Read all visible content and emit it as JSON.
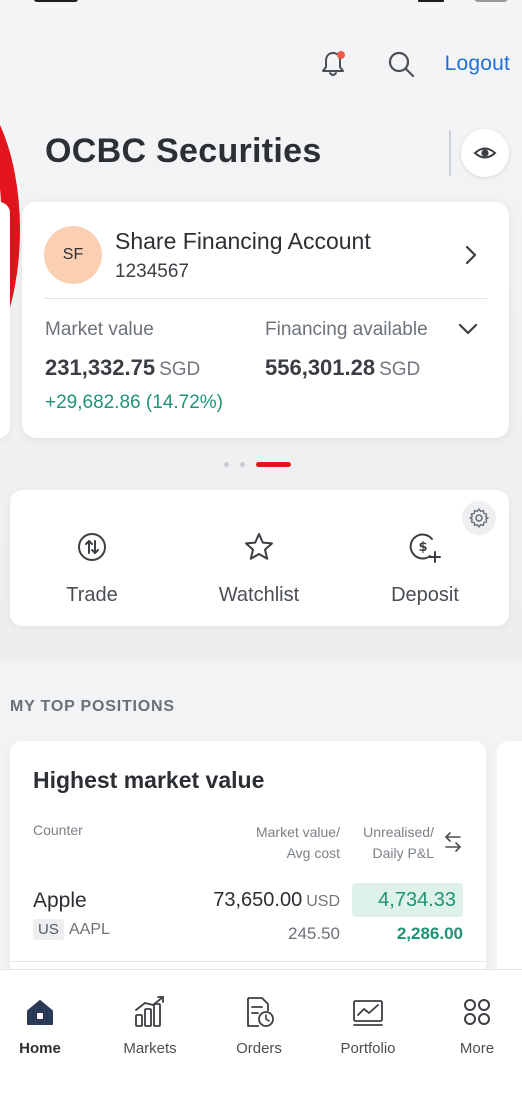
{
  "header": {
    "logout_label": "Logout",
    "brand_title": "OCBC Securities",
    "notification_dot_color": "#f25a4e"
  },
  "account": {
    "avatar_initials": "SF",
    "name": "Share Financing Account",
    "number": "1234567",
    "market_value_label": "Market value",
    "market_value": "231,332.75",
    "market_value_currency": "SGD",
    "market_value_change": "+29,682.86 (14.72%)",
    "financing_label": "Financing available",
    "financing_value": "556,301.28",
    "financing_currency": "SGD",
    "carousel_active_index": 2,
    "carousel_count": 3
  },
  "quick_actions": [
    {
      "label": "Trade",
      "icon": "trade-icon"
    },
    {
      "label": "Watchlist",
      "icon": "star-icon"
    },
    {
      "label": "Deposit",
      "icon": "deposit-icon"
    }
  ],
  "positions": {
    "section_label": "MY TOP POSITIONS",
    "card_title": "Highest market value",
    "col_counter": "Counter",
    "col_mv_line1": "Market value/",
    "col_mv_line2": "Avg cost",
    "col_unr_line1": "Unrealised/",
    "col_unr_line2": "Daily P&L",
    "rows": [
      {
        "name": "Apple",
        "market": "US",
        "ticker": "AAPL",
        "market_value": "73,650.00",
        "currency": "USD",
        "avg_cost": "245.50",
        "unrealised": "4,734.33",
        "daily_pl": "2,286.00"
      }
    ]
  },
  "bottom_nav": [
    {
      "label": "Home",
      "icon": "home-icon",
      "active": true
    },
    {
      "label": "Markets",
      "icon": "markets-icon",
      "active": false
    },
    {
      "label": "Orders",
      "icon": "orders-icon",
      "active": false
    },
    {
      "label": "Portfolio",
      "icon": "portfolio-icon",
      "active": false
    },
    {
      "label": "More",
      "icon": "more-icon",
      "active": false
    }
  ],
  "colors": {
    "brand_red": "#e2141c",
    "link_blue": "#1f6fd6",
    "positive_green": "#1e9377",
    "avatar_peach": "#fbcfb2"
  }
}
